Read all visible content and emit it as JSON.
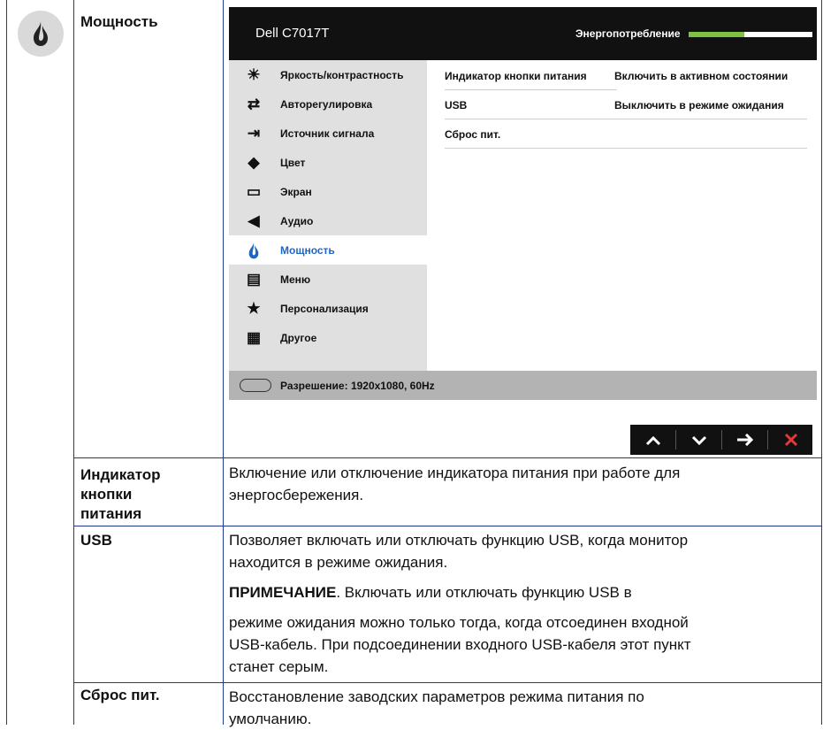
{
  "rows": [
    {
      "label": "Мощность"
    },
    {
      "label": "Индикатор кнопки питания",
      "label_lines": [
        "Индикатор",
        "кнопки",
        "питания"
      ],
      "desc": "Включение или отключение индикатора питания при работе для энергосбережения.",
      "desc_lines": [
        "Включение или отключение индикатора питания при работе для",
        "энергосбережения."
      ]
    },
    {
      "label": "USB",
      "desc_lines": [
        "Позволяет включать или отключать функцию USB, когда монитор",
        "находится в режиме ожидания."
      ],
      "note_bold": "ПРИМЕЧАНИЕ",
      "note_rest": ". Включать или отключать функцию USB в",
      "note_lines": [
        "режиме ожидания можно только тогда, когда отсоединен входной",
        "USB-кабель. При подсоединении входного USB-кабеля этот пункт",
        "станет серым."
      ]
    },
    {
      "label": "Сброс пит.",
      "desc_lines": [
        "Восстановление заводских параметров режима питания по",
        "умолчанию."
      ]
    }
  ],
  "osd": {
    "model": "Dell C7017T",
    "energy_label": "Энергопотребление",
    "energy_level": 0.45,
    "menu": [
      {
        "icon": "brightness-icon",
        "glyph": "☀",
        "label": "Яркость/контрастность"
      },
      {
        "icon": "auto-adjust-icon",
        "glyph": "⇄",
        "label": "Авторегулировка"
      },
      {
        "icon": "input-source-icon",
        "glyph": "⇥",
        "label": "Источник сигнала"
      },
      {
        "icon": "color-icon",
        "glyph": "◆",
        "label": "Цвет"
      },
      {
        "icon": "display-icon",
        "glyph": "▭",
        "label": "Экран"
      },
      {
        "icon": "audio-icon",
        "glyph": "◀",
        "label": "Аудио"
      },
      {
        "icon": "power-flame-icon",
        "glyph": "●",
        "label": "Мощность",
        "active": true
      },
      {
        "icon": "menu-icon",
        "glyph": "▤",
        "label": "Меню"
      },
      {
        "icon": "star-icon",
        "glyph": "★",
        "label": "Персонализация"
      },
      {
        "icon": "other-icon",
        "glyph": "▦",
        "label": "Другое"
      }
    ],
    "settings": [
      {
        "key": "Индикатор кнопки питания",
        "value": "Включить в активном состоянии"
      },
      {
        "key": "USB",
        "value": "Выключить в режиме ожидания"
      },
      {
        "key": "Сброс пит.",
        "value": ""
      }
    ],
    "status": "Разрешение: 1920x1080, 60Hz",
    "nav": [
      {
        "name": "up-button",
        "glyph": "⌃"
      },
      {
        "name": "down-button",
        "glyph": "⌄"
      },
      {
        "name": "next-button",
        "glyph": "→"
      },
      {
        "name": "exit-button",
        "glyph": "✕"
      }
    ],
    "accent": "#1f66c3",
    "energy_color": "#7fc241",
    "exit_color": "#e53935"
  }
}
